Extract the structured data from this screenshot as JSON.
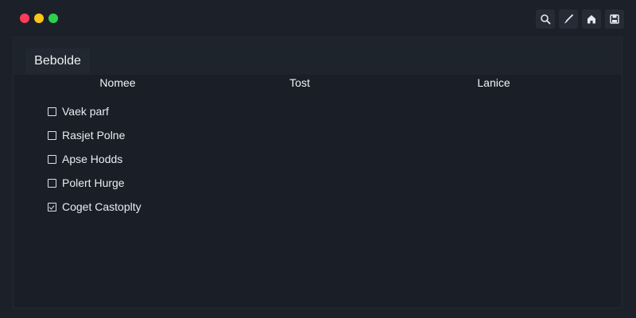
{
  "window": {
    "controls": [
      "close",
      "minimize",
      "maximize"
    ],
    "colors": {
      "close": "#ff3b5c",
      "minimize": "#ffc61a",
      "maximize": "#2bd14c"
    }
  },
  "toolbar": {
    "icons": [
      "search-icon",
      "brush-icon",
      "home-icon",
      "save-icon"
    ]
  },
  "panel": {
    "section_label": "Bebolde",
    "columns": [
      "Nomee",
      "Tost",
      "Lanice"
    ],
    "tasks": [
      {
        "label": "Vaek parf",
        "checked": false
      },
      {
        "label": "Rasjet Polne",
        "checked": false
      },
      {
        "label": "Apse Hodds",
        "checked": false
      },
      {
        "label": "Polert Hurge",
        "checked": false
      },
      {
        "label": "Coget Castoplty",
        "checked": true
      }
    ]
  }
}
